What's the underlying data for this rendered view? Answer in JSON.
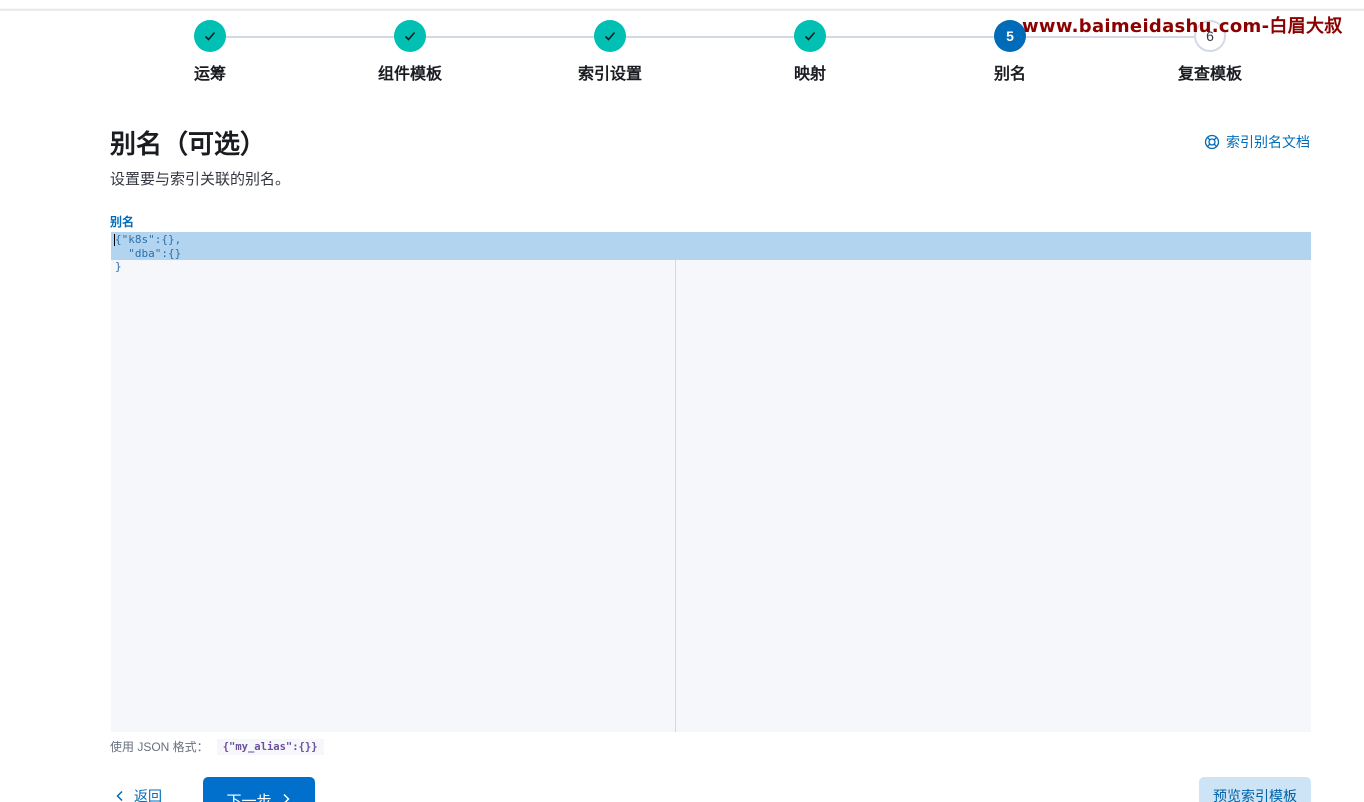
{
  "watermark": "www.baimeidashu.com-白眉大叔",
  "steps": [
    {
      "title": "运筹",
      "status": "complete",
      "number": "",
      "icon": "check-icon"
    },
    {
      "title": "组件模板",
      "status": "complete",
      "number": "",
      "icon": "check-icon"
    },
    {
      "title": "索引设置",
      "status": "complete",
      "number": "",
      "icon": "check-icon"
    },
    {
      "title": "映射",
      "status": "complete",
      "number": "",
      "icon": "check-icon"
    },
    {
      "title": "别名",
      "status": "current",
      "number": "5"
    },
    {
      "title": "复查模板",
      "status": "incomplete",
      "number": "6"
    }
  ],
  "header": {
    "title": "别名（可选）",
    "description": "设置要与索引关联的别名。",
    "doc_link": "索引别名文档",
    "doc_icon": "help-lifebuoy-icon"
  },
  "editor": {
    "label": "别名",
    "lines": [
      "{\"k8s\":{},",
      "  \"dba\":{}",
      "}"
    ]
  },
  "help": {
    "text": "使用 JSON 格式：",
    "example": "{\"my_alias\":{}}"
  },
  "footer": {
    "back_label": "返回",
    "next_label": "下一步",
    "preview_label": "预览索引模板"
  },
  "colors": {
    "step_complete": "#00bfb3",
    "step_current": "#006bb8",
    "primary": "#0070cc",
    "link": "#006bb8",
    "watermark": "#8b0000"
  }
}
